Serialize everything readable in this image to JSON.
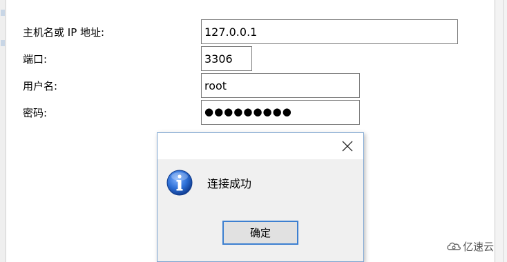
{
  "form": {
    "host_label": "主机名或 IP 地址:",
    "host_value": "127.0.0.1",
    "port_label": "端口:",
    "port_value": "3306",
    "user_label": "用户名:",
    "user_value": "root",
    "password_label": "密码:",
    "password_mask": "●●●●●●●●●"
  },
  "dialog": {
    "message": "连接成功",
    "ok_label": "确定",
    "icon": "info-icon",
    "close_icon": "close-icon"
  },
  "watermark": {
    "text": "亿速云",
    "icon": "cloud-logo"
  },
  "colors": {
    "dialog_border": "#7aa3d0",
    "ok_border": "#3c7fd0",
    "info_blue": "#1e5fbf"
  }
}
